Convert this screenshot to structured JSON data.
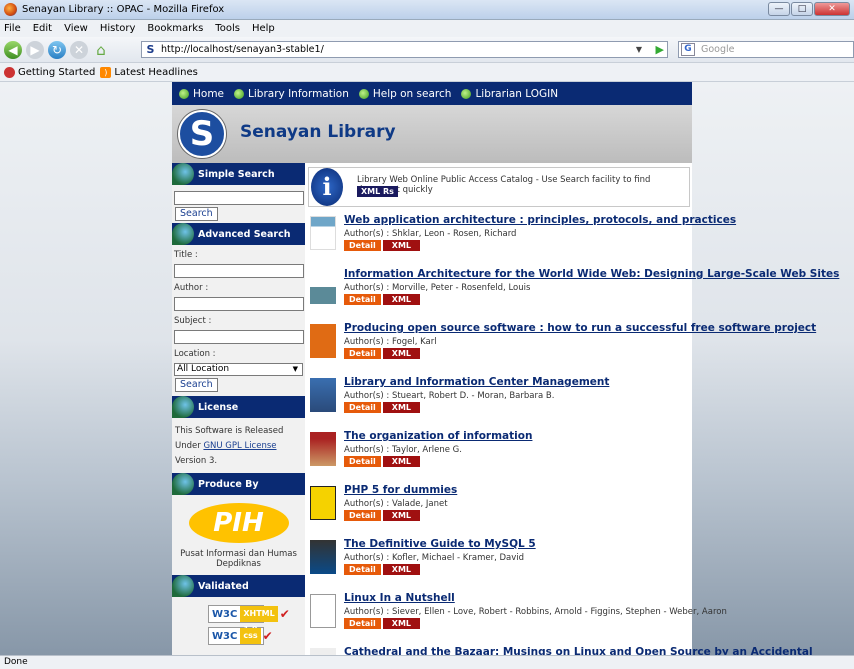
{
  "window": {
    "title": "Senayan Library :: OPAC - Mozilla Firefox"
  },
  "menu": [
    "File",
    "Edit",
    "View",
    "History",
    "Bookmarks",
    "Tools",
    "Help"
  ],
  "nav": {
    "url": "http://localhost/senayan3-stable1/",
    "search_placeholder": "Google"
  },
  "bookmarks": [
    "Getting Started",
    "Latest Headlines"
  ],
  "site": {
    "topnav": [
      "Home",
      "Library Information",
      "Help on search",
      "Librarian LOGIN"
    ],
    "logo_letter": "S",
    "name": "Senayan Library"
  },
  "sidebar": {
    "simple_search": {
      "heading": "Simple Search",
      "button": "Search"
    },
    "advanced_search": {
      "heading": "Advanced Search",
      "title_label": "Title :",
      "author_label": "Author :",
      "subject_label": "Subject :",
      "location_label": "Location :",
      "location_value": "All Location",
      "button": "Search"
    },
    "license": {
      "heading": "License",
      "text_pre": "This Software is Released Under",
      "link": "GNU GPL License",
      "text_post": "Version 3."
    },
    "produce": {
      "heading": "Produce By",
      "logo_text": "PIH",
      "caption": "Pusat Informasi dan Humas Depdiknas"
    },
    "validated": {
      "heading": "Validated",
      "w3c": "W3C",
      "xhtml": "XHTML 1.0",
      "css": "css"
    }
  },
  "info": {
    "text": "Library Web Online Public Access Catalog - Use Search facility to find document quickly",
    "xml_rss": "XML Rs",
    "icon": "i"
  },
  "buttons": {
    "detail": "Detail",
    "xml": "XML"
  },
  "items": [
    {
      "title": "Web application architecture : principles, protocols, and practices",
      "authors": "Author(s) : Shklar, Leon - Rosen, Richard"
    },
    {
      "title": "Information Architecture for the World Wide Web: Designing Large-Scale Web Sites",
      "authors": "Author(s) : Morville, Peter - Rosenfeld, Louis"
    },
    {
      "title": "Producing open source software : how to run a successful free software project",
      "authors": "Author(s) : Fogel, Karl"
    },
    {
      "title": "Library and Information Center Management",
      "authors": "Author(s) : Stueart, Robert D. - Moran, Barbara B."
    },
    {
      "title": "The organization of information",
      "authors": "Author(s) : Taylor, Arlene G."
    },
    {
      "title": "PHP 5 for dummies",
      "authors": "Author(s) : Valade, Janet"
    },
    {
      "title": "The Definitive Guide to MySQL 5",
      "authors": "Author(s) : Kofler, Michael - Kramer, David"
    },
    {
      "title": "Linux In a Nutshell",
      "authors": "Author(s) : Siever, Ellen - Love, Robert - Robbins, Arnold - Figgins, Stephen - Weber, Aaron"
    },
    {
      "title": "Cathedral and the Bazaar: Musings on Linux and Open Source by an Accidental",
      "authors": ""
    }
  ],
  "status": "Done"
}
